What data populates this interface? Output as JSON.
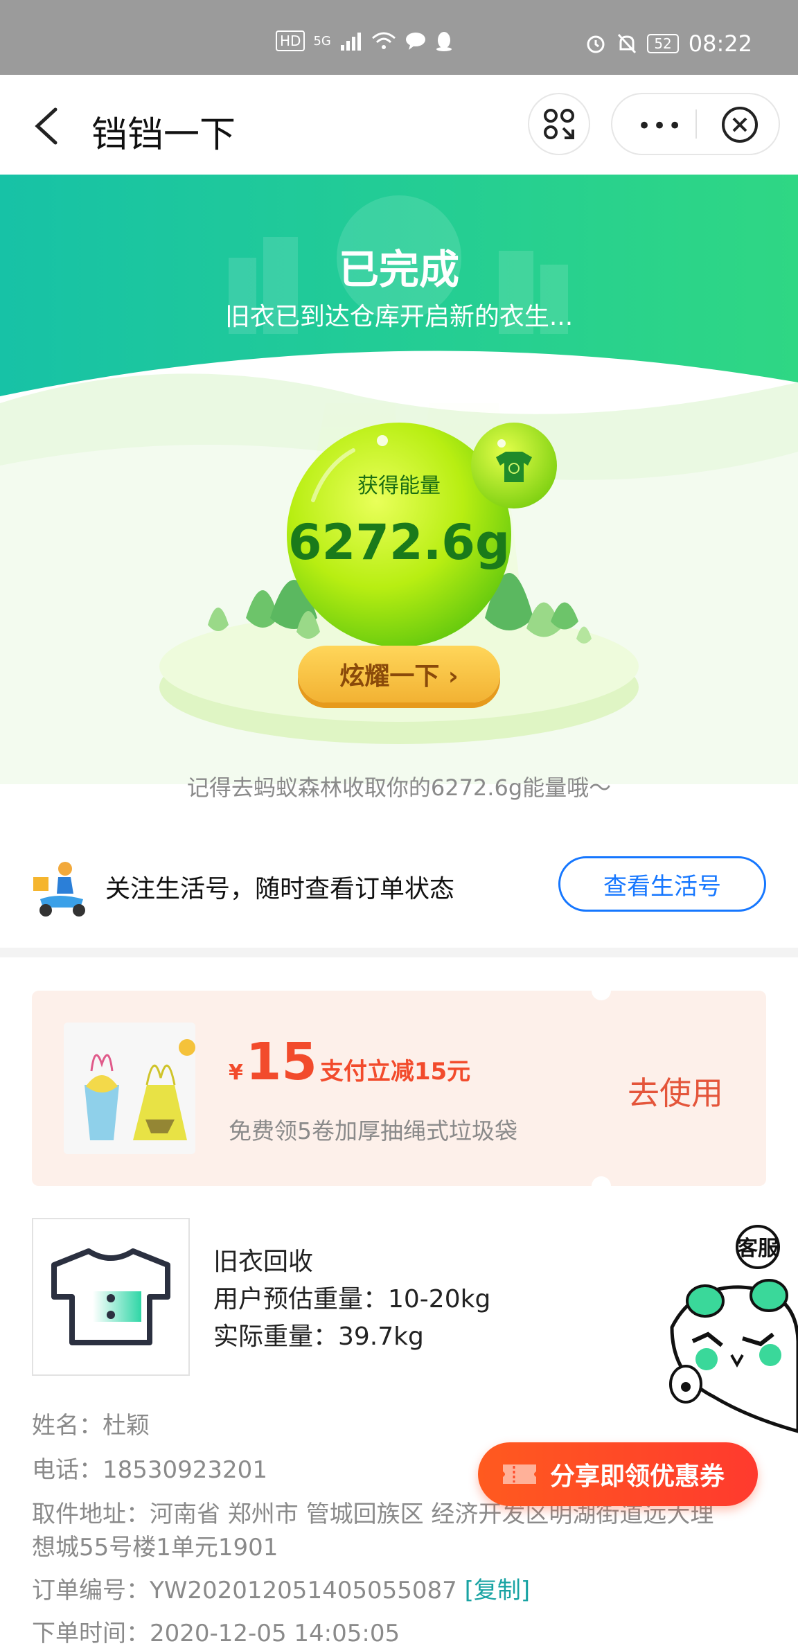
{
  "status_bar": {
    "left_badges": [
      "HD",
      "5G"
    ],
    "battery": "52",
    "time": "08:22"
  },
  "nav": {
    "title": "铛铛一下",
    "more": "•••"
  },
  "hero": {
    "status": "已完成",
    "subtitle": "旧衣已到达仓库开启新的衣生...",
    "orb_label": "获得能量",
    "energy": "6272.6g",
    "show_button": "炫耀一下 ›",
    "reminder": "记得去蚂蚁森林收取你的6272.6g能量哦～"
  },
  "follow": {
    "text": "关注生活号，随时查看订单状态",
    "button": "查看生活号"
  },
  "coupon": {
    "currency": "¥",
    "amount": "15",
    "desc": "支付立减15元",
    "note": "免费领5卷加厚抽绳式垃圾袋",
    "action": "去使用"
  },
  "product": {
    "name": "旧衣回收",
    "estimated": "用户预估重量：10-20kg",
    "actual": "实际重量：39.7kg"
  },
  "order": {
    "name_line": "姓名：杜颖",
    "phone_line": "电话：18530923201",
    "address_line1": "取件地址：河南省 郑州市 管城回族区 经济开发区明湖街道远大理",
    "address_line2": "想城55号楼1单元1901",
    "order_no_line": "订单编号：YW202012051405055087",
    "copy_label": "[复制]",
    "time_line": "下单时间：2020-12-05 14:05:05"
  },
  "floating": {
    "service_label": "客服",
    "share_button": "分享即领优惠券"
  },
  "colors": {
    "accent_blue": "#1677ff",
    "hero_green": "#2fd28a",
    "coupon_red": "#f24b2c",
    "copy_teal": "#19a3a3"
  }
}
